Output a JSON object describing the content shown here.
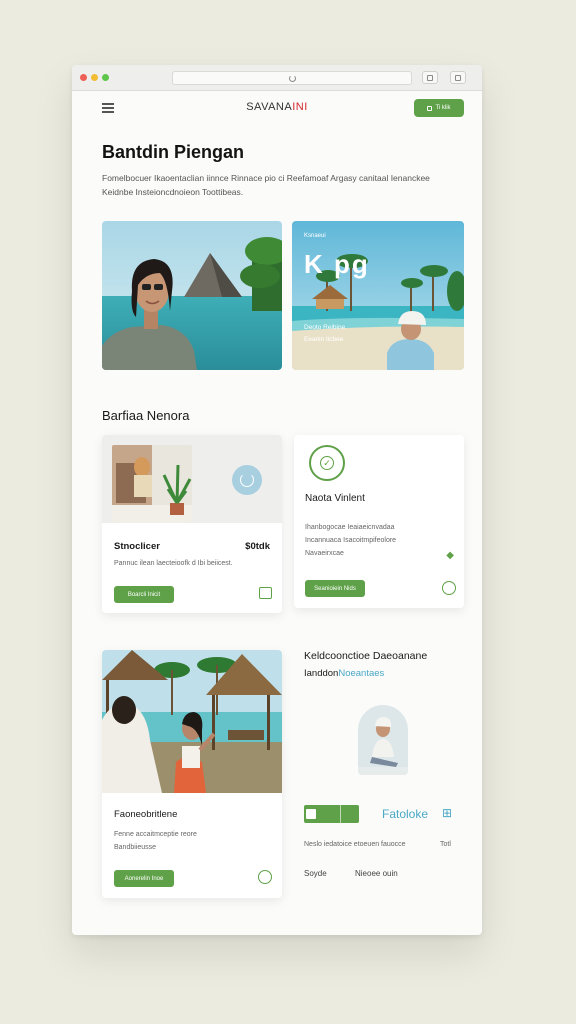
{
  "nav": {
    "brand_part1": "SAVANA",
    "brand_part2": "INI",
    "button_label": "Ti klik"
  },
  "hero": {
    "title": "Bantdin Piengan",
    "subtitle": "Fomelbocuer Ikaoentaclian iinnce Rinnace pio ci Reefamoaf Argasy canitaal Ienanckee Keidnbe Insteioncdnoieon Toottibeas."
  },
  "images": {
    "right_overlay_big": "K  pg",
    "right_overlay_small1": "Ksnaeui",
    "right_overlay_small2": "Deoto Reibine\nEeanin ticbee"
  },
  "section": {
    "title": "Barfiaa Nenora"
  },
  "card1": {
    "title": "Stnoclicer",
    "price": "$0tdk",
    "text": "Pannuc ilean laecteioofk d Ibi beiicest.",
    "button": "Boarcli Inicit"
  },
  "card2": {
    "title": "Naota Vinlent",
    "text": "Ihanbogocae Ieaiaeicnvadaa\nIncannuaca Isacoitmpifeolore\nNavaeirxcae",
    "button": "Seanioiein Nids"
  },
  "card3": {
    "title": "Faoneobritlene",
    "text": "Fenne accaitmceptie reore\nBandbiieusse",
    "button": "Aonerelin Inoe"
  },
  "right_block": {
    "title": "Keldcoonctioe Daeoanane",
    "sub_part1": "Ianddon",
    "sub_part2": "Noeantaes",
    "badge": "Fatoloke",
    "meta_text": "Neslo iedatoice etoeuen fauocce",
    "meta_value": "Totl",
    "link1": "Soyde",
    "link2": "Nieoee ouin"
  },
  "colors": {
    "accent_green": "#5fa148",
    "brand_red": "#d1262b",
    "accent_teal": "#4aa9c7"
  }
}
